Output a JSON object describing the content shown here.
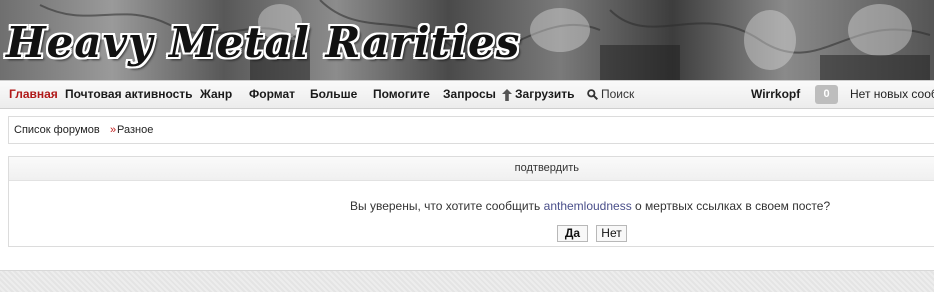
{
  "header": {
    "site_title": "Heavy Metal Rarities"
  },
  "nav": {
    "items": [
      "Главная",
      "Почтовая активность",
      "Жанр",
      "Формат",
      "Больше",
      "Помогите",
      "Запросы"
    ],
    "upload_label": "Загрузить",
    "search_label": "Поиск",
    "username": "Wirrkopf",
    "notification_count": "0",
    "notification_text": "Нет новых сообщений"
  },
  "breadcrumb": {
    "root": "Список форумов",
    "separator": "»",
    "current": "Разное"
  },
  "confirm": {
    "title": "подтвердить",
    "question_before": "Вы уверены, что хотите сообщить",
    "username": "anthemloudness",
    "question_after": "о мертвых ссылках в своем посте?",
    "yes_label": "Да",
    "no_label": "Нет"
  },
  "colors": {
    "active_nav": "#b01818",
    "link_user": "#4a4f8a",
    "breadcrumb_sep": "#c02020"
  },
  "icons": {
    "upload": "upload-arrow-icon",
    "search": "magnifier-icon"
  }
}
